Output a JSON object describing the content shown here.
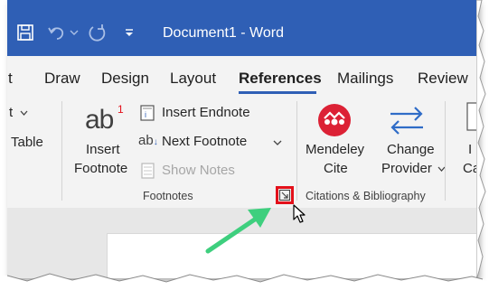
{
  "window": {
    "title": "Document1  -  Word"
  },
  "tabs": [
    {
      "label": "t"
    },
    {
      "label": "Draw"
    },
    {
      "label": "Design"
    },
    {
      "label": "Layout"
    },
    {
      "label": "References",
      "active": true
    },
    {
      "label": "Mailings"
    },
    {
      "label": "Review"
    }
  ],
  "ribbon": {
    "left_partial": {
      "top_text": "t",
      "bottom_text": "Table"
    },
    "footnotes": {
      "insert_footnote_icon_text": "ab",
      "insert_footnote_superscript": "1",
      "insert_footnote_label_line1": "Insert",
      "insert_footnote_label_line2": "Footnote",
      "insert_endnote": "Insert Endnote",
      "next_footnote_icon_text": "ab",
      "next_footnote": "Next Footnote",
      "show_notes": "Show Notes",
      "group_label": "Footnotes"
    },
    "citations": {
      "mendeley_line1": "Mendeley",
      "mendeley_line2": "Cite",
      "change_provider_line1": "Change",
      "change_provider_line2": "Provider",
      "group_label": "Citations & Bibliography"
    },
    "right_partial": {
      "line1": "I",
      "line2": "Ca"
    }
  },
  "colors": {
    "titlebar": "#2f5fb5",
    "accent_blue": "#2f5fb5",
    "highlight_red": "#e3101a",
    "arrow_green": "#3ecf7e",
    "mendeley_red": "#dc2135"
  }
}
